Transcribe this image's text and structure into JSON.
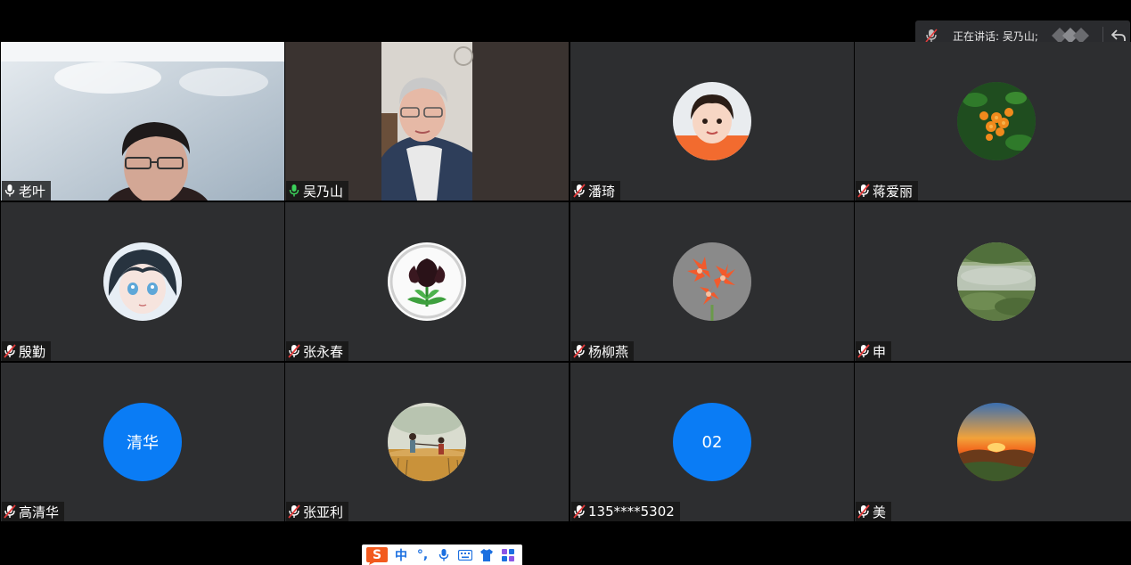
{
  "speaking": {
    "label": "正在讲话: 吴乃山;"
  },
  "participants": [
    {
      "name": "老叶",
      "mic": "on",
      "type": "video"
    },
    {
      "name": "吴乃山",
      "mic": "speaking",
      "type": "video"
    },
    {
      "name": "潘琦",
      "mic": "muted",
      "type": "photo",
      "icon": "girl-portrait"
    },
    {
      "name": "蒋爱丽",
      "mic": "muted",
      "type": "photo",
      "icon": "orange-flowers"
    },
    {
      "name": "殷勤",
      "mic": "muted",
      "type": "photo",
      "icon": "anime-girl"
    },
    {
      "name": "张永春",
      "mic": "muted",
      "type": "photo",
      "icon": "black-calla-lily"
    },
    {
      "name": "杨柳燕",
      "mic": "muted",
      "type": "photo",
      "icon": "red-amaryllis"
    },
    {
      "name": "申",
      "mic": "muted",
      "type": "photo",
      "icon": "pond-landscape"
    },
    {
      "name": "高清华",
      "mic": "muted",
      "type": "text",
      "avatar_text": "清华",
      "color": "#0a7cf5"
    },
    {
      "name": "张亚利",
      "mic": "muted",
      "type": "photo",
      "icon": "wheat-field-people"
    },
    {
      "name": "135****5302",
      "mic": "muted",
      "type": "text",
      "avatar_text": "02",
      "color": "#0a7cf5"
    },
    {
      "name": "美",
      "mic": "muted",
      "type": "photo",
      "icon": "sunset-landscape"
    }
  ],
  "ime": {
    "logo": "S",
    "mode": "中",
    "punct": "°,",
    "items": [
      "mic-icon",
      "keyboard-icon",
      "shirt-icon",
      "grid-icon"
    ]
  },
  "colors": {
    "tile_bg": "#2d2e30",
    "active_border": "#36b24a",
    "text_avatar_blue": "#0a7cf5",
    "mic_on": "#ffffff",
    "mic_speaking": "#3bd15a",
    "mic_muted_red": "#e23a3a"
  }
}
